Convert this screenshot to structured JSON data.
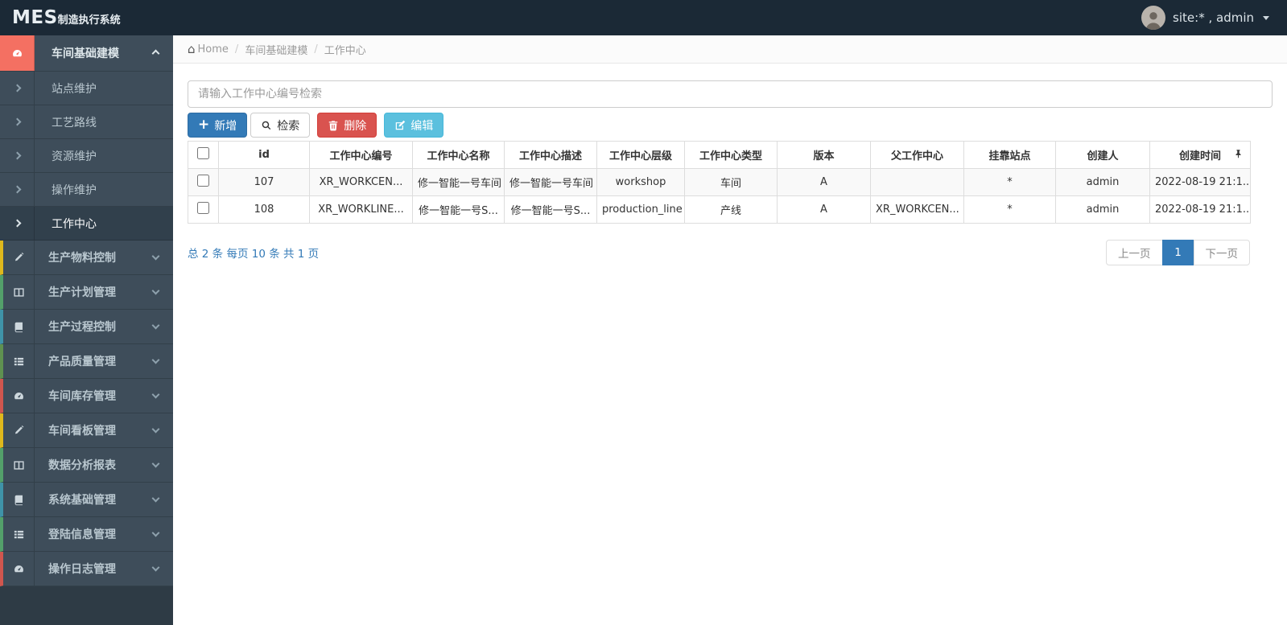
{
  "app": {
    "brand_bold": "MES",
    "brand_rest": "制造执行系统",
    "user_label": "site:* , admin"
  },
  "colors": {
    "navbar_bg": "#1b2936",
    "sidebar_item_bg": "#3e4d5a",
    "accent_coral": "#f47062",
    "primary_blue": "#337ab7",
    "danger_red": "#d9534f",
    "info_blue": "#5bc0de"
  },
  "sidebar": {
    "group_open": {
      "label": "车间基础建模",
      "icon": "dashboard-icon"
    },
    "submenu": [
      {
        "label": "站点维护"
      },
      {
        "label": "工艺路线"
      },
      {
        "label": "资源维护"
      },
      {
        "label": "操作维护"
      },
      {
        "label": "工作中心",
        "active": true
      }
    ],
    "groups": [
      {
        "label": "生产物料控制",
        "icon": "pencil-icon",
        "strip_color": "#dfb81c"
      },
      {
        "label": "生产计划管理",
        "icon": "columns-icon",
        "strip_color": "#53a06a"
      },
      {
        "label": "生产过程控制",
        "icon": "book-icon",
        "strip_color": "#3f93a8"
      },
      {
        "label": "产品质量管理",
        "icon": "list-icon",
        "strip_color": "#5f9150"
      },
      {
        "label": "车间库存管理",
        "icon": "dashboard-icon",
        "strip_color": "#d0564e"
      },
      {
        "label": "车间看板管理",
        "icon": "pencil-icon",
        "strip_color": "#dfb81c"
      },
      {
        "label": "数据分析报表",
        "icon": "columns-icon",
        "strip_color": "#53a06a"
      },
      {
        "label": "系统基础管理",
        "icon": "book-icon",
        "strip_color": "#3f93a8"
      },
      {
        "label": "登陆信息管理",
        "icon": "list-icon",
        "strip_color": "#53a06a"
      },
      {
        "label": "操作日志管理",
        "icon": "dashboard-icon",
        "strip_color": "#d0564e"
      }
    ]
  },
  "breadcrumb": {
    "home": "Home",
    "crumbs": [
      "车间基础建模",
      "工作中心"
    ]
  },
  "toolbar": {
    "search_placeholder": "请输入工作中心编号检索",
    "add_label": "新增",
    "search_label": "检索",
    "delete_label": "删除",
    "edit_label": "编辑"
  },
  "table": {
    "columns": [
      "id",
      "工作中心编号",
      "工作中心名称",
      "工作中心描述",
      "工作中心层级",
      "工作中心类型",
      "版本",
      "父工作中心",
      "挂靠站点",
      "创建人",
      "创建时间"
    ],
    "rows": [
      {
        "cells": [
          "107",
          "XR_WORKCEN...",
          "修一智能一号车间",
          "修一智能一号车间",
          "workshop",
          "车间",
          "A",
          "",
          "*",
          "admin",
          "2022-08-19 21:1..."
        ]
      },
      {
        "cells": [
          "108",
          "XR_WORKLINE...",
          "修一智能一号S...",
          "修一智能一号S...",
          "production_line",
          "产线",
          "A",
          "XR_WORKCEN...",
          "*",
          "admin",
          "2022-08-19 21:1..."
        ]
      }
    ]
  },
  "pagination": {
    "summary": "总 2 条  每页 10 条  共 1 页",
    "prev": "上一页",
    "current": "1",
    "next": "下一页"
  }
}
